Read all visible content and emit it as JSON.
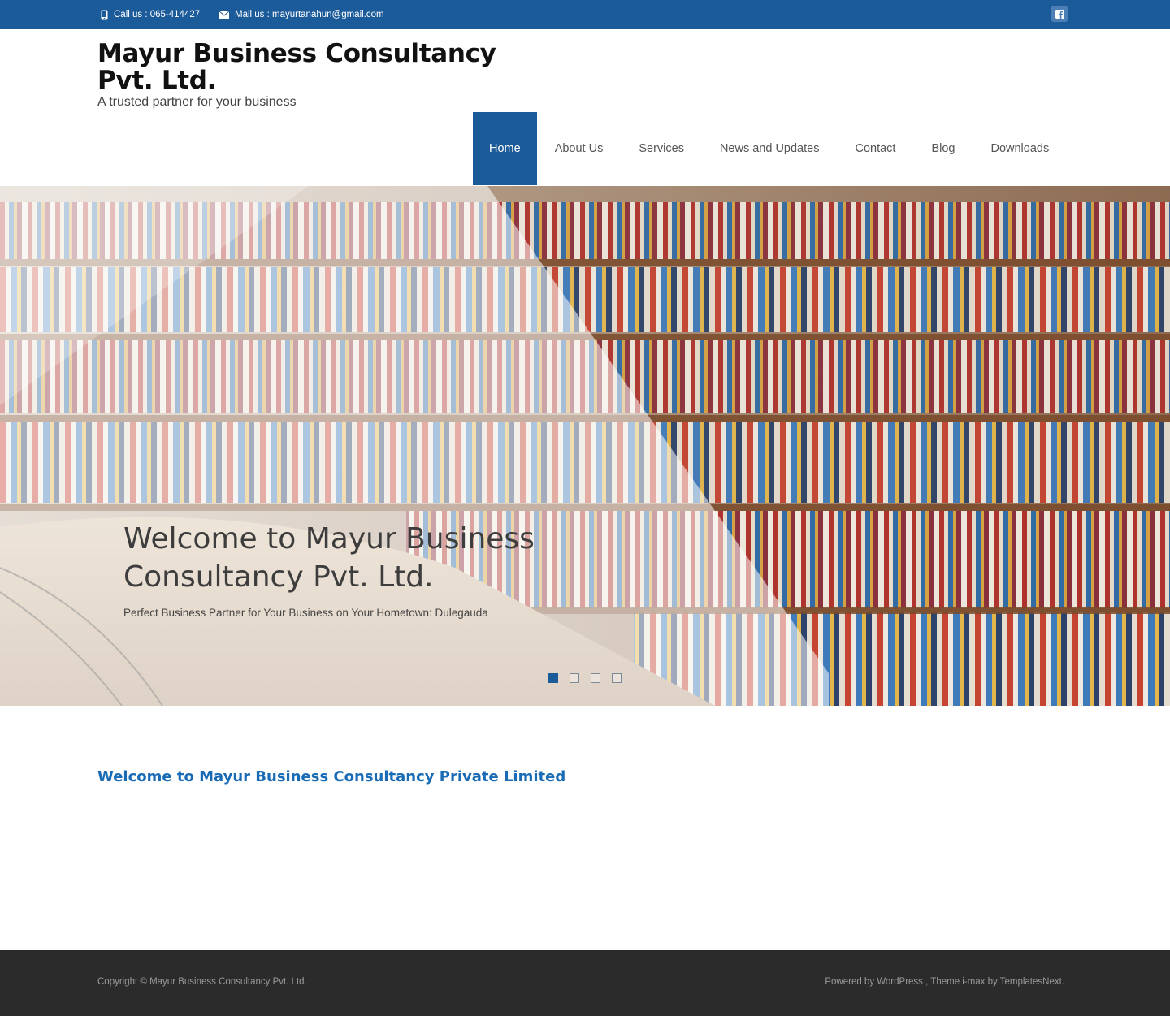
{
  "topbar": {
    "phone_text": "Call us : 065-414427",
    "mail_text": "Mail us : mayurtanahun@gmail.com",
    "phone_icon": "mobile-phone-icon",
    "mail_icon": "envelope-icon",
    "facebook_icon": "facebook-icon",
    "color": "#1c5b9a"
  },
  "header": {
    "site_title": "Mayur Business Consultancy Pvt. Ltd.",
    "tagline": "A trusted partner for your business"
  },
  "nav": {
    "items": [
      {
        "label": "Home",
        "active": true
      },
      {
        "label": "About Us"
      },
      {
        "label": "Services"
      },
      {
        "label": "News and Updates"
      },
      {
        "label": "Contact"
      },
      {
        "label": "Blog"
      },
      {
        "label": "Downloads"
      }
    ]
  },
  "hero": {
    "title": "Welcome to Mayur Business Consultancy Pvt. Ltd.",
    "subtitle": "Perfect Business Partner for Your Business on Your Hometown: Dulegauda",
    "slide_count": 4,
    "active_slide": 1
  },
  "main": {
    "welcome_heading": "Welcome to Mayur Business Consultancy Private Limited",
    "heading_color": "#1a6bb5"
  },
  "footer": {
    "copyright": "Copyright © Mayur Business Consultancy Pvt. Ltd.",
    "powered_by": "Powered by WordPress , Theme i-max by TemplatesNext."
  }
}
